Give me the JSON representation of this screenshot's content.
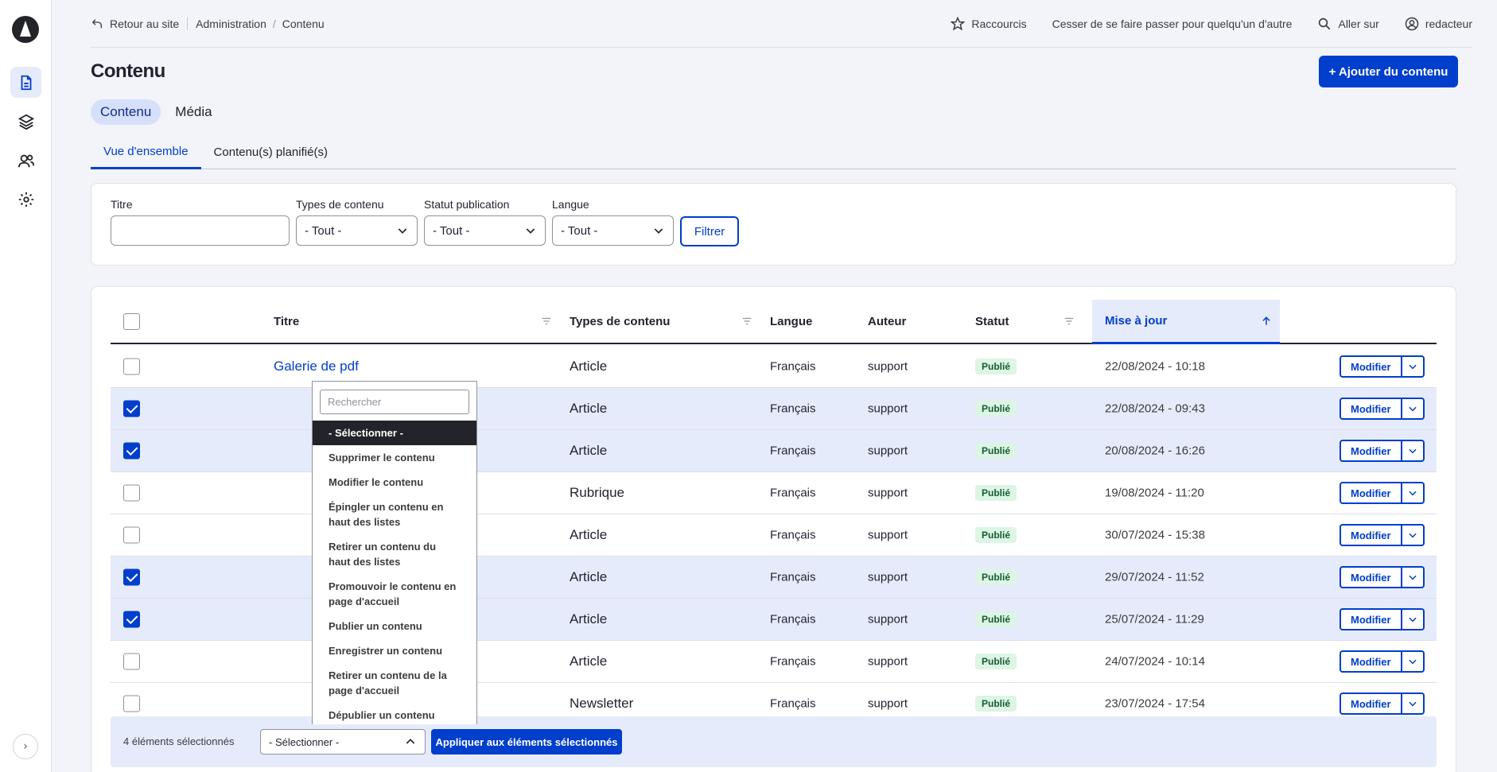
{
  "topbar": {
    "back_label": "Retour au site",
    "breadcrumbs": [
      "Administration",
      "Contenu"
    ],
    "shortcuts": "Raccourcis",
    "impersonate": "Cesser de se faire passer pour quelqu'un d'autre",
    "goto": "Aller sur",
    "user": "redacteur"
  },
  "page": {
    "title": "Contenu",
    "add_button": "+ Ajouter du contenu"
  },
  "tabs": [
    "Contenu",
    "Média"
  ],
  "subtabs": [
    "Vue d'ensemble",
    "Contenu(s) planifié(s)"
  ],
  "filters": {
    "title_label": "Titre",
    "title_value": "",
    "type_label": "Types de contenu",
    "type_value": "- Tout -",
    "status_label": "Statut publication",
    "status_value": "- Tout -",
    "lang_label": "Langue",
    "lang_value": "- Tout -",
    "submit": "Filtrer"
  },
  "table": {
    "headers": {
      "title": "Titre",
      "type": "Types de contenu",
      "lang": "Langue",
      "author": "Auteur",
      "status": "Statut",
      "updated": "Mise à jour"
    },
    "edit_label": "Modifier",
    "rows": [
      {
        "checked": false,
        "title": "Galerie de pdf",
        "type": "Article",
        "lang": "Français",
        "author": "support",
        "status": "Publié",
        "date": "22/08/2024 - 10:18"
      },
      {
        "checked": true,
        "title": "",
        "type": "Article",
        "lang": "Français",
        "author": "support",
        "status": "Publié",
        "date": "22/08/2024 - 09:43"
      },
      {
        "checked": true,
        "title": "",
        "type": "Article",
        "lang": "Français",
        "author": "support",
        "status": "Publié",
        "date": "20/08/2024 - 16:26"
      },
      {
        "checked": false,
        "title": "",
        "type": "Rubrique",
        "lang": "Français",
        "author": "support",
        "status": "Publié",
        "date": "19/08/2024 - 11:20"
      },
      {
        "checked": false,
        "title": "",
        "type": "Article",
        "lang": "Français",
        "author": "support",
        "status": "Publié",
        "date": "30/07/2024 - 15:38"
      },
      {
        "checked": true,
        "title": "",
        "type": "Article",
        "lang": "Français",
        "author": "support",
        "status": "Publié",
        "date": "29/07/2024 - 11:52"
      },
      {
        "checked": true,
        "title": "",
        "type": "Article",
        "lang": "Français",
        "author": "support",
        "status": "Publié",
        "date": "25/07/2024 - 11:29"
      },
      {
        "checked": false,
        "title": "",
        "type": "Article",
        "lang": "Français",
        "author": "support",
        "status": "Publié",
        "date": "24/07/2024 - 10:14"
      },
      {
        "checked": false,
        "title": "",
        "type": "Newsletter",
        "lang": "Français",
        "author": "support",
        "status": "Publié",
        "date": "23/07/2024 - 17:54"
      }
    ]
  },
  "bulk": {
    "count_label": "4 éléments sélectionnés",
    "select_value": "- Sélectionner -",
    "apply_label": "Appliquer aux éléments sélectionnés"
  },
  "dropdown": {
    "search_placeholder": "Rechercher",
    "items": [
      "- Sélectionner -",
      "Supprimer le contenu",
      "Modifier le contenu",
      "Épingler un contenu en haut des listes",
      "Retirer un contenu du haut des listes",
      "Promouvoir le contenu en page d'accueil",
      "Publier un contenu",
      "Enregistrer un contenu",
      "Retirer un contenu de la page d'accueil",
      "Dépublier un contenu"
    ]
  },
  "colors": {
    "accent": "#003ecc",
    "selected_row": "#e6ebfb",
    "status_badge_bg": "#dcf5e4"
  }
}
